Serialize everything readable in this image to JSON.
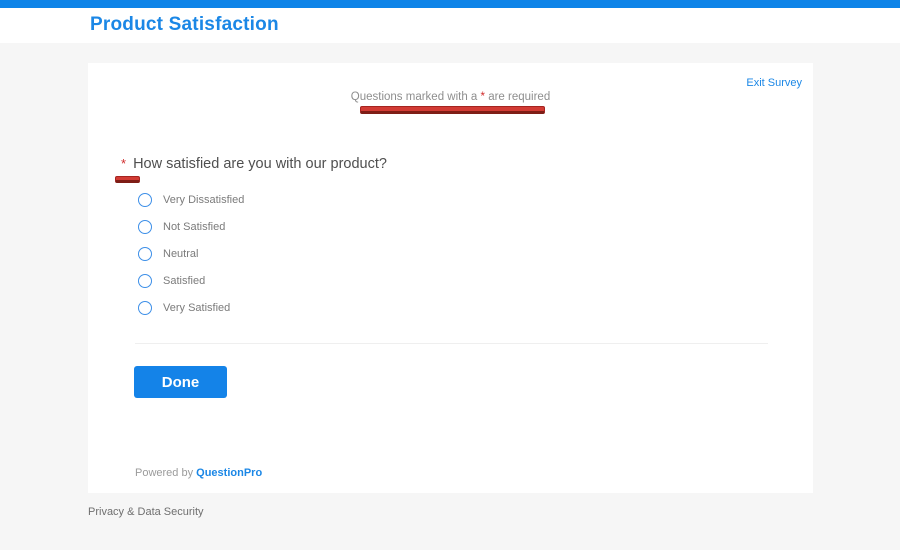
{
  "app": {
    "title": "Product Satisfaction"
  },
  "survey": {
    "exit_link": "Exit Survey",
    "required_note": {
      "before": "Questions marked with a ",
      "star": "*",
      "after": " are required"
    },
    "question": {
      "star": "*",
      "text": "How satisfied are you with our product?"
    },
    "options": [
      {
        "label": "Very Dissatisfied"
      },
      {
        "label": "Not Satisfied"
      },
      {
        "label": "Neutral"
      },
      {
        "label": "Satisfied"
      },
      {
        "label": "Very Satisfied"
      }
    ],
    "done_button": "Done",
    "powered_by": {
      "prefix": "Powered by ",
      "brand": "QuestionPro"
    }
  },
  "footer": {
    "privacy_link": "Privacy & Data Security"
  },
  "colors": {
    "accent_blue": "#1b87e6",
    "top_bar_blue": "#0e84e8",
    "button_blue": "#1483e8",
    "annotation_red": "#d23b34",
    "annotation_red_dark": "#7e1d16",
    "page_background": "#f6f6f6",
    "card_background": "#ffffff",
    "question_text": "#4f4f4f",
    "muted_text": "#8e8e8e"
  }
}
